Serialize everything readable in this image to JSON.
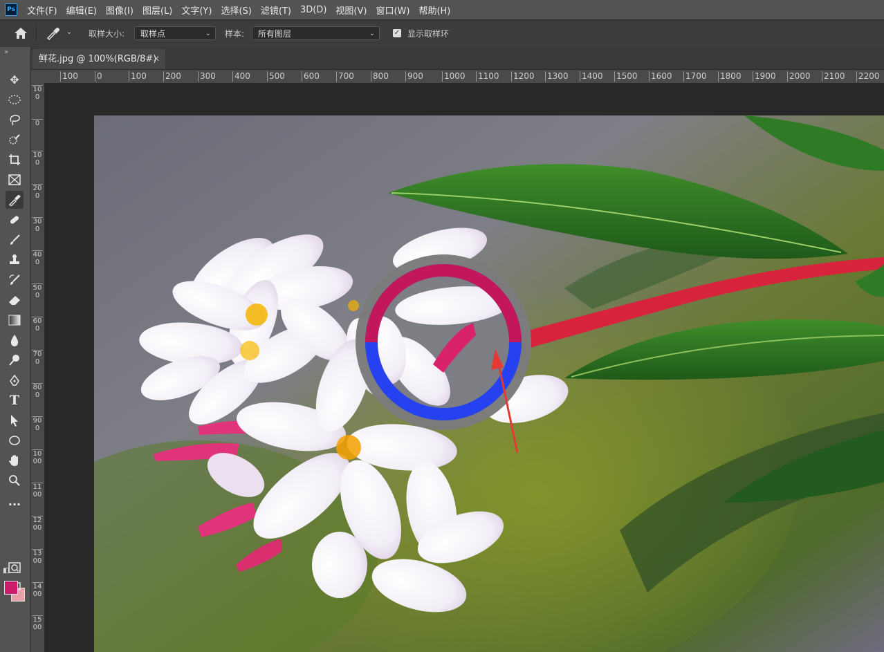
{
  "menubar": {
    "logo": "Ps",
    "items": [
      "文件(F)",
      "编辑(E)",
      "图像(I)",
      "图层(L)",
      "文字(Y)",
      "选择(S)",
      "滤镜(T)",
      "3D(D)",
      "视图(V)",
      "窗口(W)",
      "帮助(H)"
    ]
  },
  "options": {
    "sample_size_label": "取样大小:",
    "sample_size_value": "取样点",
    "sample_label": "样本:",
    "sample_value": "所有图层",
    "show_ring_label": "显示取样环",
    "show_ring_checked": true
  },
  "document": {
    "tab_title": "鲜花.jpg @ 100%(RGB/8#)"
  },
  "rulers": {
    "horizontal": [
      "100",
      "0",
      "100",
      "200",
      "300",
      "400",
      "500",
      "600",
      "700",
      "800",
      "900",
      "1000",
      "1100",
      "1200",
      "1300",
      "1400",
      "1500",
      "1600",
      "1700",
      "1800",
      "1900",
      "2000",
      "2100",
      "2200"
    ],
    "vertical": [
      "100",
      "0",
      "100",
      "200",
      "300",
      "400",
      "500",
      "600",
      "700",
      "800",
      "900",
      "1000",
      "1100",
      "1200",
      "1300",
      "1400",
      "1500"
    ]
  },
  "colors": {
    "foreground": "#c91d6c",
    "background": "#e8a0a6",
    "ring_new": "#c2185b",
    "ring_current": "#2641f0"
  },
  "tools": [
    "move-icon",
    "marquee-icon",
    "lasso-icon",
    "quick-select-icon",
    "crop-icon",
    "frame-icon",
    "eyedropper-icon",
    "healing-icon",
    "brush-icon",
    "stamp-icon",
    "history-brush-icon",
    "eraser-icon",
    "gradient-icon",
    "blur-icon",
    "dodge-icon",
    "pen-icon",
    "type-icon",
    "path-select-icon",
    "ellipse-icon",
    "hand-icon",
    "zoom-icon",
    "more-icon",
    "quick-mask-icon",
    "screen-mode-icon"
  ]
}
